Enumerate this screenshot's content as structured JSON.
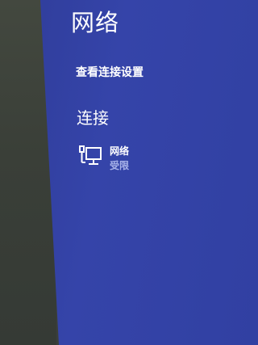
{
  "charm": {
    "title": "网络",
    "view_connection_settings": "查看连接设置",
    "section_connections": "连接",
    "connections": [
      {
        "name": "网络",
        "status": "受限",
        "icon": "ethernet-icon"
      }
    ]
  },
  "colors": {
    "panel_blue": "#3443a6",
    "text_primary": "#ffffff",
    "text_secondary": "#a9b4ea"
  }
}
